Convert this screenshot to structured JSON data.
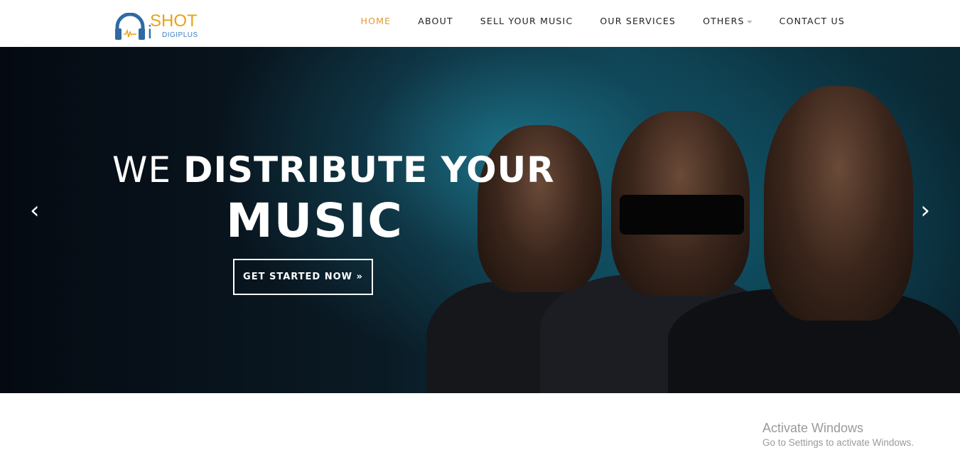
{
  "logo": {
    "i": "i",
    "shot": "SHOT",
    "sub": "DIGIPLUS"
  },
  "nav": [
    {
      "label": "HOME",
      "active": true
    },
    {
      "label": "ABOUT"
    },
    {
      "label": "SELL YOUR MUSIC"
    },
    {
      "label": "OUR SERVICES"
    },
    {
      "label": "OTHERS"
    },
    {
      "label": "CONTACT US"
    }
  ],
  "hero": {
    "title_light": "WE ",
    "title_bold": "DISTRIBUTE YOUR",
    "title_line2": "MUSIC",
    "cta": "GET STARTED NOW »",
    "prev": "‹",
    "next": "›"
  },
  "watermark": {
    "line1": "Activate Windows",
    "line2": "Go to Settings to activate Windows."
  },
  "colors": {
    "accent": "#e09b2d",
    "logo_blue": "#2f6aa3"
  }
}
